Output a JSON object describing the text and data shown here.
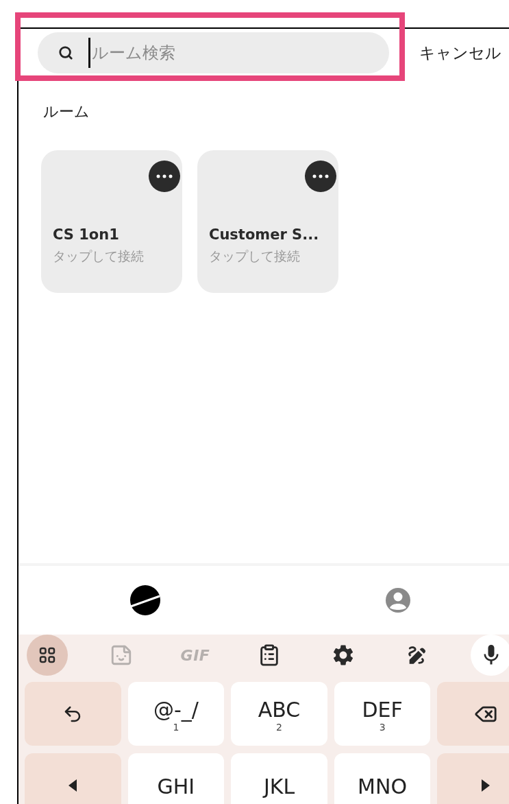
{
  "search": {
    "placeholder": "ルーム検索",
    "focused": true
  },
  "highlight": {
    "color": "#e6457a"
  },
  "cancel": "キャンセル",
  "section_title": "ルーム",
  "rooms": [
    {
      "name": "CS 1on1",
      "subtitle": "タップして接続"
    },
    {
      "name": "Customer S...",
      "subtitle": "タップして接続"
    }
  ],
  "bottom_nav": [
    {
      "kind": "planet",
      "selected": true
    },
    {
      "kind": "account",
      "selected": false
    }
  ],
  "keyboard_toolbar": [
    {
      "kind": "apps",
      "selected": true,
      "disabled": false
    },
    {
      "kind": "sticker",
      "selected": false,
      "disabled": true
    },
    {
      "kind": "gif",
      "label": "GIF",
      "selected": false,
      "disabled": true
    },
    {
      "kind": "clipboard",
      "selected": false,
      "disabled": false
    },
    {
      "kind": "settings",
      "selected": false,
      "disabled": false
    },
    {
      "kind": "handwriting",
      "selected": false,
      "disabled": false
    },
    {
      "kind": "mic",
      "selected": false,
      "disabled": false
    }
  ],
  "keys": [
    [
      {
        "kind": "undo"
      },
      {
        "kind": "letters",
        "label": "@-_/",
        "sub": "1"
      },
      {
        "kind": "letters",
        "label": "ABC",
        "sub": "2"
      },
      {
        "kind": "letters",
        "label": "DEF",
        "sub": "3"
      },
      {
        "kind": "backspace"
      }
    ],
    [
      {
        "kind": "left"
      },
      {
        "kind": "letters",
        "label": "GHI"
      },
      {
        "kind": "letters",
        "label": "JKL"
      },
      {
        "kind": "letters",
        "label": "MNO"
      },
      {
        "kind": "right"
      }
    ]
  ]
}
